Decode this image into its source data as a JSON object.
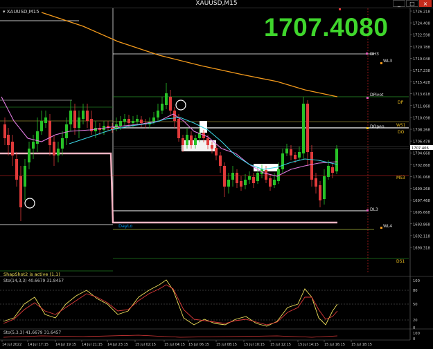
{
  "window": {
    "title": "XAUUSD,M15",
    "min_label": "_",
    "max_label": "□",
    "close_label": "×"
  },
  "chart": {
    "symbol_label": "XAUUSD,M15",
    "current_price_big": "1707.4080",
    "day_low_label": "DayLo",
    "shapshot_label": "ShapShot2 is active (1,1)"
  },
  "price_axis": {
    "ticks": [
      "1726.218",
      "1724.408",
      "1722.598",
      "1720.788",
      "1719.048",
      "1717.238",
      "1715.428",
      "1713.618",
      "1711.868",
      "1710.098",
      "1708.268",
      "1706.478",
      "1704.668",
      "1702.868",
      "1701.068",
      "1699.268",
      "1697.468",
      "1695.668",
      "1693.868",
      "1692.118",
      "1690.318"
    ],
    "current_price_tag": "1707.406"
  },
  "pivot_labels": {
    "DH3": "DH3",
    "WL3": "WL3",
    "DPivot": "DPivot",
    "DP": "DP",
    "DOpen": "DOpen",
    "WS1": "WS1",
    "DO": "DO",
    "MS3": "MS3",
    "DL3": "DL3",
    "WL4": "WL4",
    "DS1": "DS1"
  },
  "indicator1": {
    "label": "Sto(14,3,3) 40.6679 31.8457",
    "ticks": [
      "100",
      "80",
      "50",
      "20",
      "0"
    ]
  },
  "indicator2": {
    "label": "Sto(5,3,3) 41.6679 31.6457",
    "ticks": [
      "100",
      "0"
    ]
  },
  "time_axis": {
    "labels": [
      "14 Jul 2022",
      "14 Jul 17:15",
      "14 Jul 19:15",
      "14 Jul 21:15",
      "14 Jul 23:15",
      "15 Jul 02:15",
      "15 Jul 04:15",
      "15 Jul 06:15",
      "15 Jul 08:15",
      "15 Jul 10:15",
      "15 Jul 12:15",
      "15 Jul 14:15",
      "15 Jul 16:15",
      "15 Jul 18:15"
    ]
  },
  "colors": {
    "bull": "#27c227",
    "bear": "#e03a3a",
    "ma_slow": "#f39a1c",
    "ma_fast": "#3ad1e0",
    "ma_mid": "#e07be0",
    "price_green": "#3fd62c",
    "stoch_main": "#f0e05a",
    "stoch_signal": "#e03a3a"
  }
}
